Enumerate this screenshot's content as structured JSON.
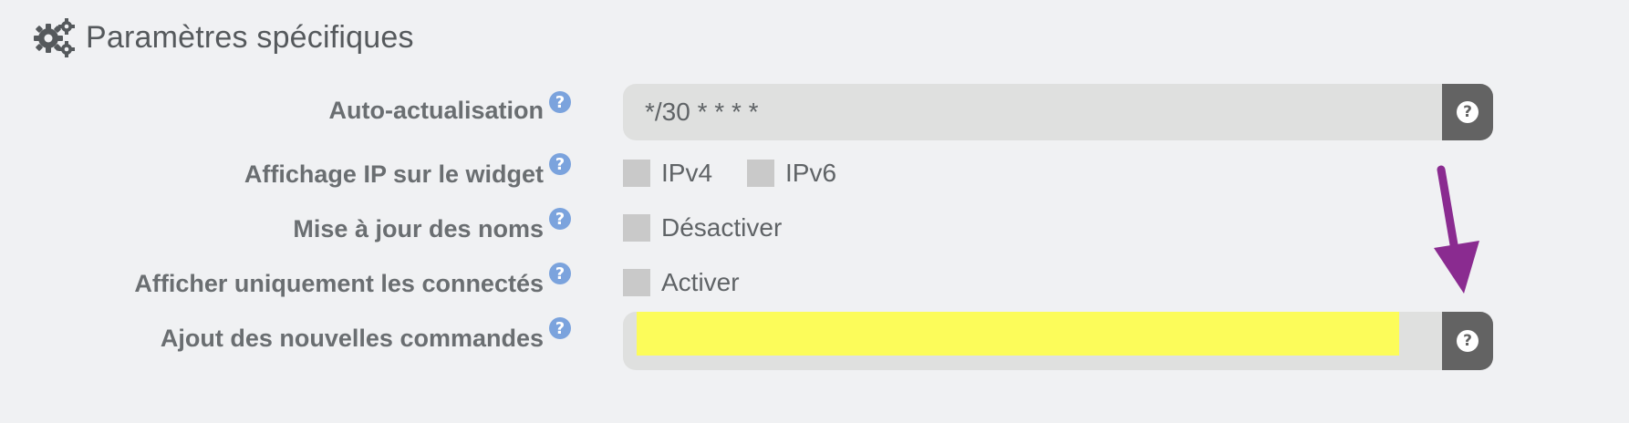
{
  "section": {
    "title": "Paramètres spécifiques",
    "icon": "gears-icon"
  },
  "fields": {
    "auto_refresh": {
      "label": "Auto-actualisation",
      "value": "*/30 * * * *"
    },
    "ip_display": {
      "label": "Affichage IP sur le widget",
      "options": [
        "IPv4",
        "IPv6"
      ]
    },
    "name_update": {
      "label": "Mise à jour des noms",
      "option": "Désactiver"
    },
    "connected_only": {
      "label": "Afficher uniquement les connectés",
      "option": "Activer"
    },
    "new_commands": {
      "label": "Ajout des nouvelles commandes",
      "value": ""
    }
  },
  "help_glyph": "?",
  "colors": {
    "help_icon": "#7ba3dd",
    "addon_button": "#636363",
    "highlight": "#fcfc5a",
    "arrow": "#8a2b90"
  }
}
